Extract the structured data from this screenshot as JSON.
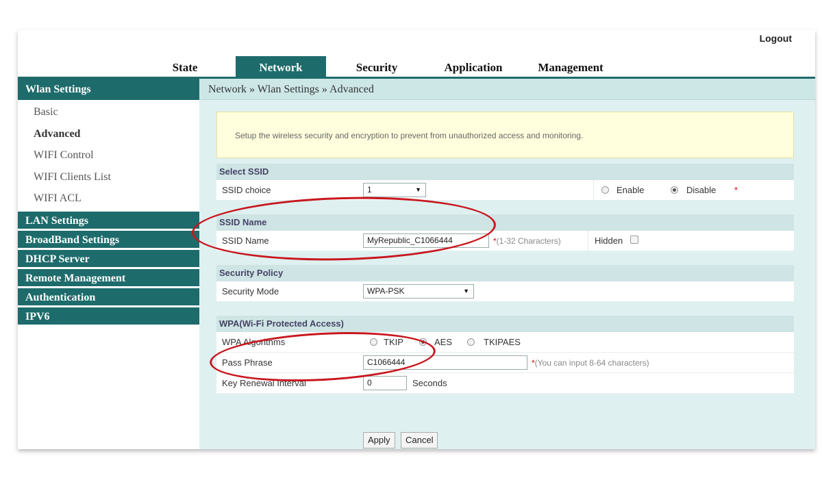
{
  "header": {
    "logout_label": "Logout"
  },
  "nav": {
    "tabs": [
      {
        "label": "State",
        "active": false
      },
      {
        "label": "Network",
        "active": true
      },
      {
        "label": "Security",
        "active": false
      },
      {
        "label": "Application",
        "active": false
      },
      {
        "label": "Management",
        "active": false
      }
    ]
  },
  "sidebar": {
    "groups": [
      {
        "label": "Wlan Settings",
        "items": [
          "Basic",
          "Advanced",
          "WIFI Control",
          "WIFI Clients List",
          "WIFI ACL"
        ],
        "active_item": "Advanced"
      },
      {
        "label": "LAN Settings"
      },
      {
        "label": "BroadBand Settings"
      },
      {
        "label": "DHCP Server"
      },
      {
        "label": "Remote Management"
      },
      {
        "label": "Authentication"
      },
      {
        "label": "IPV6"
      }
    ]
  },
  "breadcrumb": "Network » Wlan Settings » Advanced",
  "notice": "Setup the wireless security and encryption to prevent from unauthorized access and monitoring.",
  "select_ssid": {
    "title": "Select SSID",
    "label": "SSID choice",
    "value": "1",
    "enable_label": "Enable",
    "disable_label": "Disable",
    "selected": "Disable",
    "required_mark": "*"
  },
  "ssid_name": {
    "title": "SSID Name",
    "label": "SSID Name",
    "value": "MyRepublic_C1066444",
    "hint_mark": "*",
    "hint": "(1-32 Characters)",
    "hidden_label": "Hidden"
  },
  "security_policy": {
    "title": "Security Policy",
    "label": "Security Mode",
    "value": "WPA-PSK"
  },
  "wpa": {
    "title": "WPA(Wi-Fi Protected Access)",
    "algorithms_label": "WPA Algorithms",
    "algorithms": [
      "TKIP",
      "AES",
      "TKIPAES"
    ],
    "selected_algorithm": "AES",
    "pass_label": "Pass Phrase",
    "pass_value": "C1066444",
    "pass_hint_mark": "*",
    "pass_hint": "(You can input 8-64 characters)",
    "renewal_label": "Key Renewal Interval",
    "renewal_value": "0",
    "renewal_unit": "Seconds"
  },
  "buttons": {
    "apply": "Apply",
    "cancel": "Cancel"
  },
  "colors": {
    "primary": "#1e6b6b",
    "content_bg": "#dff0f0",
    "notice_bg": "#ffffdd",
    "highlight": "#c8171f"
  },
  "icons": {
    "dropdown": "triangle-down-icon"
  }
}
